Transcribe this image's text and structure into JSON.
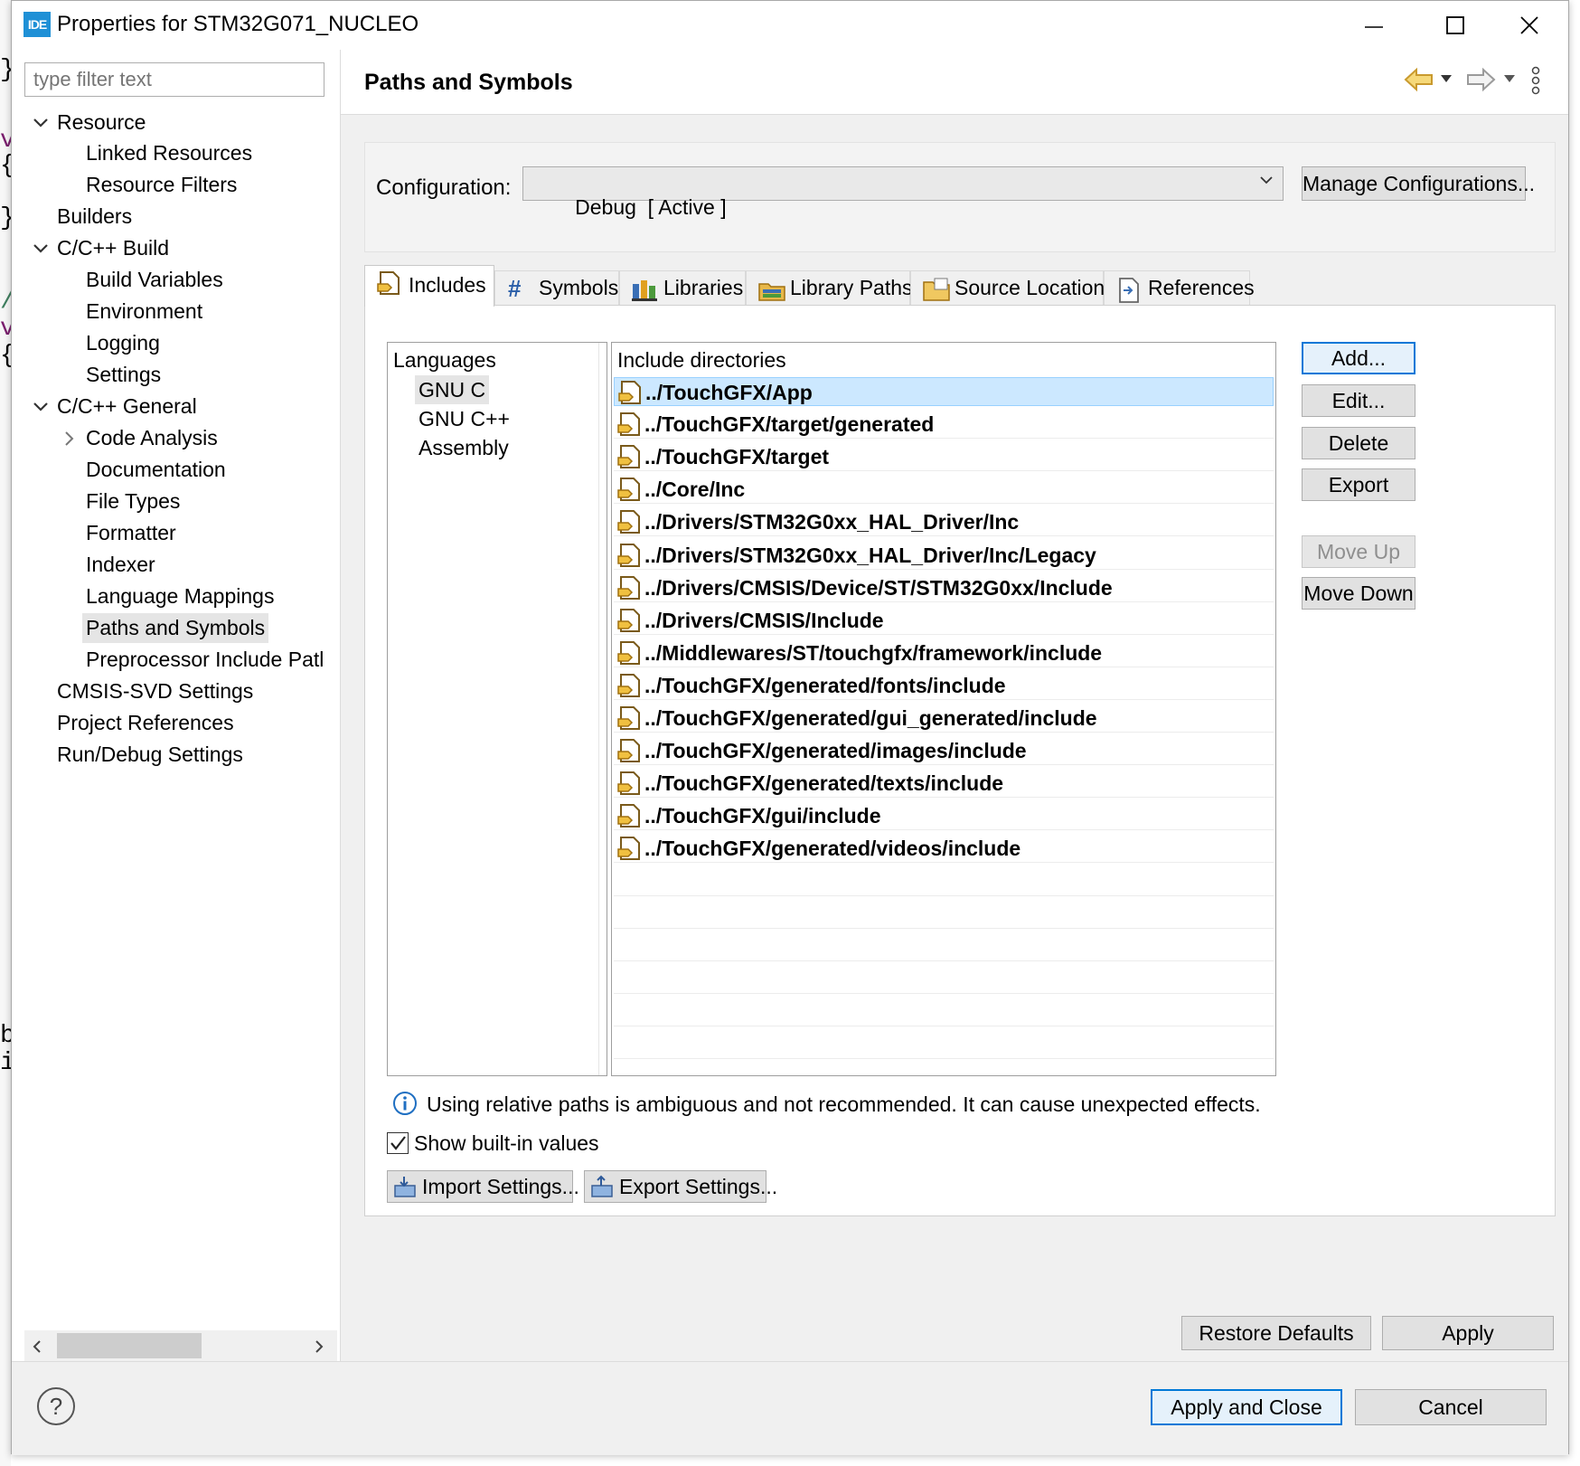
{
  "window": {
    "logo_text": "IDE",
    "title": "Properties for STM32G071_NUCLEO"
  },
  "filter": {
    "placeholder": "type filter text"
  },
  "tree": [
    {
      "label": "Resource",
      "expanded": true
    },
    {
      "label": "Linked Resources"
    },
    {
      "label": "Resource Filters"
    },
    {
      "label": "Builders"
    },
    {
      "label": "C/C++ Build",
      "expanded": true
    },
    {
      "label": "Build Variables"
    },
    {
      "label": "Environment"
    },
    {
      "label": "Logging"
    },
    {
      "label": "Settings"
    },
    {
      "label": "C/C++ General",
      "expanded": true
    },
    {
      "label": "Code Analysis",
      "expanded": false
    },
    {
      "label": "Documentation"
    },
    {
      "label": "File Types"
    },
    {
      "label": "Formatter"
    },
    {
      "label": "Indexer"
    },
    {
      "label": "Language Mappings"
    },
    {
      "label": "Paths and Symbols",
      "selected": true
    },
    {
      "label": "Preprocessor Include Patl"
    },
    {
      "label": "CMSIS-SVD Settings"
    },
    {
      "label": "Project References"
    },
    {
      "label": "Run/Debug Settings"
    }
  ],
  "page": {
    "title": "Paths and Symbols",
    "configuration_label": "Configuration:",
    "configuration_value": "Debug  [ Active ]",
    "manage_button": "Manage Configurations..."
  },
  "tabs": [
    {
      "label": "Includes",
      "icon": "includes-icon",
      "active": true
    },
    {
      "label": "Symbols",
      "icon": "hash-icon"
    },
    {
      "label": "Libraries",
      "icon": "libraries-icon"
    },
    {
      "label": "Library Paths",
      "icon": "library-paths-icon"
    },
    {
      "label": "Source Location",
      "icon": "folder-icon"
    },
    {
      "label": "References",
      "icon": "references-icon"
    }
  ],
  "languages": {
    "header": "Languages",
    "items": [
      {
        "label": "GNU C",
        "selected": true
      },
      {
        "label": "GNU C++"
      },
      {
        "label": "Assembly"
      }
    ]
  },
  "includes": {
    "header": "Include directories",
    "rows": [
      "../TouchGFX/App",
      "../TouchGFX/target/generated",
      "../TouchGFX/target",
      "../Core/Inc",
      "../Drivers/STM32G0xx_HAL_Driver/Inc",
      "../Drivers/STM32G0xx_HAL_Driver/Inc/Legacy",
      "../Drivers/CMSIS/Device/ST/STM32G0xx/Include",
      "../Drivers/CMSIS/Include",
      "../Middlewares/ST/touchgfx/framework/include",
      "../TouchGFX/generated/fonts/include",
      "../TouchGFX/generated/gui_generated/include",
      "../TouchGFX/generated/images/include",
      "../TouchGFX/generated/texts/include",
      "../TouchGFX/gui/include",
      "../TouchGFX/generated/videos/include"
    ],
    "selected_index": 0
  },
  "side_buttons": {
    "add": "Add...",
    "edit": "Edit...",
    "delete": "Delete",
    "export": "Export",
    "move_up": "Move Up",
    "move_down": "Move Down"
  },
  "info_message": "Using relative paths is ambiguous and not recommended. It can cause unexpected effects.",
  "show_builtin": {
    "label": "Show built-in values",
    "checked": true
  },
  "import_settings": "Import Settings...",
  "export_settings": "Export Settings...",
  "restore_defaults": "Restore Defaults",
  "apply": "Apply",
  "apply_and_close": "Apply and Close",
  "cancel": "Cancel",
  "help_symbol": "?",
  "backdrop_chars": [
    "}",
    "v",
    "{",
    "}",
    "/",
    "v",
    "{",
    "b",
    "i"
  ],
  "colors": {
    "accent": "#0078d7",
    "selection": "#cce8ff",
    "info": "#1f6fc2"
  }
}
